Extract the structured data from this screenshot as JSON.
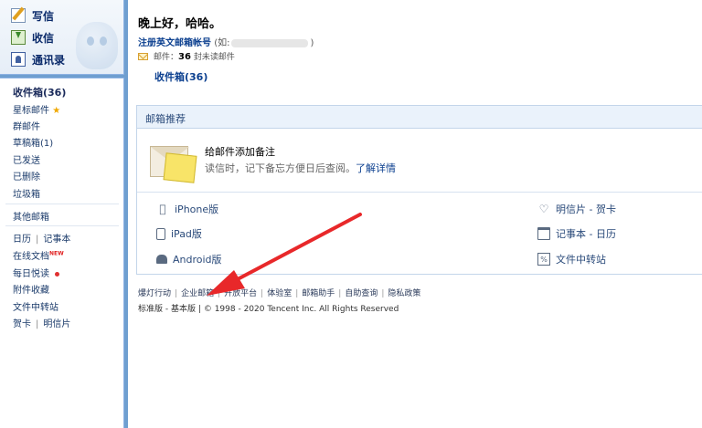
{
  "sidebar_top": {
    "compose_label": "写信",
    "inbox_label": "收信",
    "contacts_label": "通讯录"
  },
  "sidebar_nav": {
    "inbox": "收件箱(36)",
    "starred": "星标邮件",
    "groups": "群邮件",
    "drafts": "草稿箱(1)",
    "sent": "已发送",
    "deleted": "已删除",
    "spam": "垃圾箱",
    "other": "其他邮箱",
    "calendar": "日历",
    "notepad": "记事本",
    "online_docs": "在线文档",
    "new_badge": "NEW",
    "daily_read": "每日悦读",
    "attachments": "附件收藏",
    "file_transfer": "文件中转站",
    "greeting_card": "贺卡",
    "postcard": "明信片"
  },
  "main": {
    "greeting": "晚上好，哈哈。",
    "register_link": "注册英文邮箱帐号",
    "register_hint_prefix": "(如:",
    "register_hint_suffix": ")",
    "unread_prefix": "邮件：",
    "unread_count": "36",
    "unread_suffix": "封未读邮件",
    "inbox_link": "收件箱(36)"
  },
  "recommend": {
    "header": "邮箱推荐",
    "title": "给邮件添加备注",
    "desc": "读信时，记下备忘方便日后查阅。",
    "more_link": "了解详情",
    "apps": {
      "iphone": "iPhone版",
      "ipad": "iPad版",
      "android": "Android版",
      "postcard_card": "明信片 - 贺卡",
      "notepad_calendar": "记事本 - 日历",
      "file_transfer": "文件中转站"
    }
  },
  "footer": {
    "links": [
      "爆灯行动",
      "企业邮箱",
      "开放平台",
      "体验室",
      "邮箱助手",
      "自助查询",
      "隐私政策"
    ],
    "version_std": "标准版",
    "version_dash": "-",
    "version_basic": "基本版",
    "copyright": "© 1998 - 2020 Tencent Inc. All Rights Reserved"
  },
  "colors": {
    "frame_blue": "#6f9fd0",
    "link_blue": "#0b3f8f",
    "arrow_red": "#e8282a"
  }
}
